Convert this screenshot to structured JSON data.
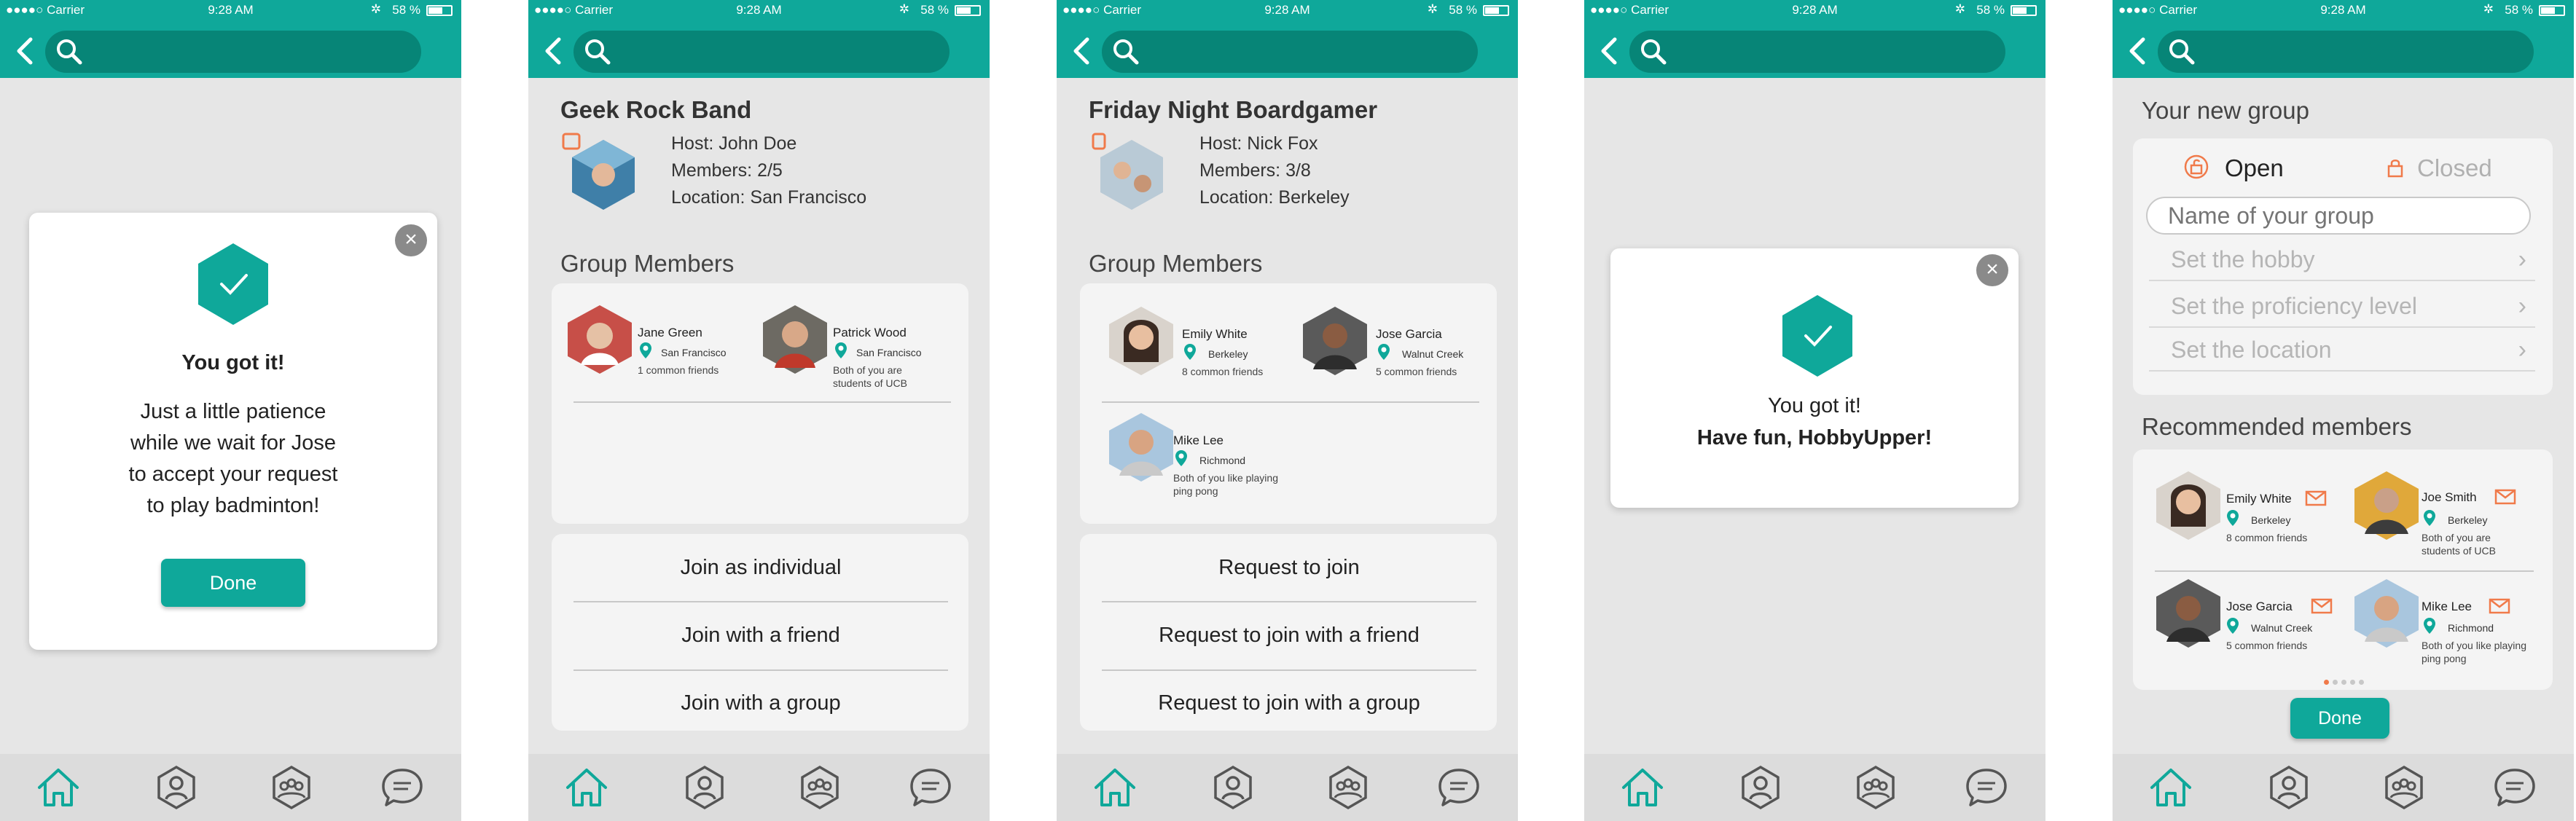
{
  "status": {
    "carrier": "●●●●○ Carrier",
    "time": "9:28 AM",
    "battery": "58 %"
  },
  "search": {
    "placeholder": ""
  },
  "colors": {
    "teal": "#0fa89a",
    "teal_dark": "#078577",
    "orange": "#f07a4a",
    "background": "#e6e6e6"
  },
  "tabs": [
    {
      "icon": "home-icon"
    },
    {
      "icon": "profile-hexagon-icon"
    },
    {
      "icon": "group-hexagon-icon"
    },
    {
      "icon": "chat-bubble-icon"
    }
  ],
  "screen1": {
    "heading": "You got it!",
    "message_lines": [
      "Just a little patience",
      "while we wait for Jose",
      "to accept your request",
      "to play badminton!"
    ],
    "done_label": "Done"
  },
  "screen2": {
    "group_name": "Geek Rock Band",
    "host": "Host: John Doe",
    "members": "Members: 2/5",
    "location": "Location: San Francisco",
    "members_title": "Group Members",
    "member_list": [
      {
        "name": "Jane Green",
        "location": "San Francisco",
        "note": "1 common friends"
      },
      {
        "name": "Patrick Wood",
        "location": "San Francisco",
        "note": "Both of you are students of UCB"
      }
    ],
    "actions": [
      "Join as individual",
      "Join with a friend",
      "Join with a group"
    ]
  },
  "screen3": {
    "group_name": "Friday Night Boardgamer",
    "host": "Host: Nick Fox",
    "members": "Members: 3/8",
    "location": "Location: Berkeley",
    "members_title": "Group Members",
    "member_list": [
      {
        "name": "Emily White",
        "location": "Berkeley",
        "note": "8 common friends"
      },
      {
        "name": "Jose Garcia",
        "location": "Walnut Creek",
        "note": "5 common friends"
      },
      {
        "name": "Mike Lee",
        "location": "Richmond",
        "note": "Both of you like playing ping pong"
      }
    ],
    "actions": [
      "Request to join",
      "Request to join with a friend",
      "Request to join with a group"
    ]
  },
  "screen4": {
    "line1": "You got it!",
    "line2": "Have fun, HobbyUpper!"
  },
  "screen5": {
    "title": "Your new group",
    "open_label": "Open",
    "closed_label": "Closed",
    "name_placeholder": "Name of your group",
    "hobby_label": "Set the hobby",
    "proficiency_label": "Set the proficiency level",
    "location_label": "Set the location",
    "recommended_title": "Recommended members",
    "member_list": [
      {
        "name": "Emily White",
        "location": "Berkeley",
        "note": "8 common friends"
      },
      {
        "name": "Joe Smith",
        "location": "Berkeley",
        "note": "Both of you are students of UCB"
      },
      {
        "name": "Jose Garcia",
        "location": "Walnut Creek",
        "note": "5 common friends"
      },
      {
        "name": "Mike Lee",
        "location": "Richmond",
        "note": "Both of you like playing ping pong"
      }
    ],
    "done_label": "Done"
  }
}
